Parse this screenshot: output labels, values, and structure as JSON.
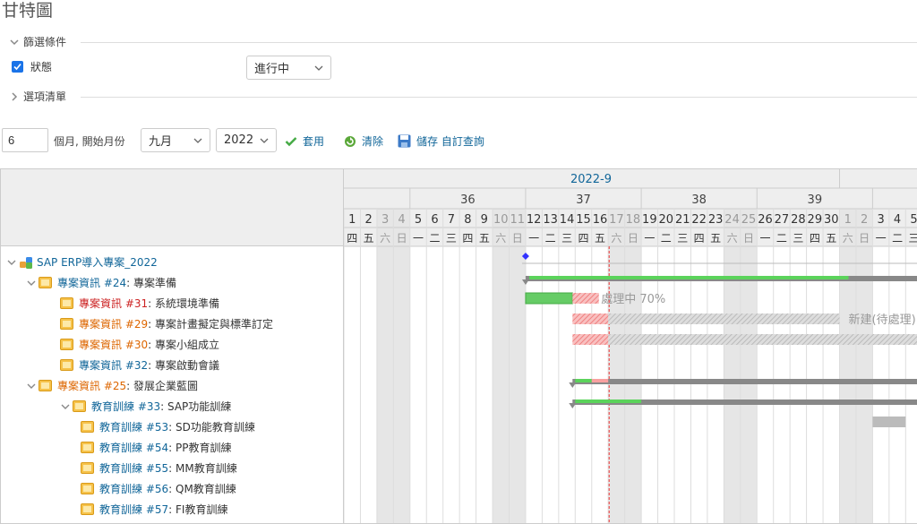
{
  "page": {
    "title": "甘特圖"
  },
  "filters": {
    "legend": "篩選條件",
    "status_label": "狀態",
    "status_checked": true,
    "status_value": "進行中"
  },
  "options": {
    "legend": "選項清單"
  },
  "toolbar": {
    "months": "6",
    "months_suffix": "個月, 開始月份",
    "month": "九月",
    "year": "2022",
    "apply": "套用",
    "clear": "清除",
    "save": "儲存 自訂查詢"
  },
  "timeline": {
    "month_label": "2022-9",
    "weeks": [
      "36",
      "37",
      "38",
      "39"
    ],
    "days": [
      "1",
      "2",
      "3",
      "4",
      "5",
      "6",
      "7",
      "8",
      "9",
      "10",
      "11",
      "12",
      "13",
      "14",
      "15",
      "16",
      "17",
      "18",
      "19",
      "20",
      "21",
      "22",
      "23",
      "24",
      "25",
      "26",
      "27",
      "28",
      "29",
      "30",
      "1",
      "2",
      "3",
      "4",
      "5"
    ],
    "weekdays": [
      "四",
      "五",
      "六",
      "日",
      "一",
      "二",
      "三",
      "四",
      "五",
      "六",
      "日",
      "一",
      "二",
      "三",
      "四",
      "五",
      "六",
      "日",
      "一",
      "二",
      "三",
      "四",
      "五",
      "六",
      "日",
      "一",
      "二",
      "三",
      "四",
      "五",
      "六",
      "日",
      "一",
      "二",
      "三"
    ]
  },
  "tree": [
    {
      "level": 0,
      "kind": "project",
      "link": "SAP ERP導入專案_2022",
      "text": "",
      "color": "#169"
    },
    {
      "level": 1,
      "kind": "issue",
      "link": "專案資訊 #24",
      "text": ": 專案準備",
      "color": "#169"
    },
    {
      "level": 2,
      "kind": "issue",
      "link": "專案資訊 #31",
      "text": ": 系統環境準備",
      "color": "#c22"
    },
    {
      "level": 2,
      "kind": "issue",
      "link": "專案資訊 #29",
      "text": ": 專案計畫擬定與標準訂定",
      "color": "#d60"
    },
    {
      "level": 2,
      "kind": "issue",
      "link": "專案資訊 #30",
      "text": ": 專案小組成立",
      "color": "#d60"
    },
    {
      "level": 2,
      "kind": "issue",
      "link": "專案資訊 #32",
      "text": ": 專案啟動會議",
      "color": "#169"
    },
    {
      "level": 1,
      "kind": "issue",
      "link": "專案資訊 #25",
      "text": ": 發展企業藍圖",
      "color": "#d60"
    },
    {
      "level": 2,
      "kind": "issue",
      "link": "教育訓練 #33",
      "text": ": SAP功能訓練",
      "color": "#169"
    },
    {
      "level": 3,
      "kind": "issue",
      "link": "教育訓練 #53",
      "text": ": SD功能教育訓練",
      "color": "#169"
    },
    {
      "level": 3,
      "kind": "issue",
      "link": "教育訓練 #54",
      "text": ": PP教育訓練",
      "color": "#169"
    },
    {
      "level": 3,
      "kind": "issue",
      "link": "教育訓練 #55",
      "text": ": MM教育訓練",
      "color": "#169"
    },
    {
      "level": 3,
      "kind": "issue",
      "link": "教育訓練 #56",
      "text": ": QM教育訓練",
      "color": "#169"
    },
    {
      "level": 3,
      "kind": "issue",
      "link": "教育訓練 #57",
      "text": ": FI教育訓練",
      "color": "#169"
    }
  ],
  "bar_labels": {
    "in_progress": "處理中 70%",
    "new_pending": "新建(待處理)"
  }
}
